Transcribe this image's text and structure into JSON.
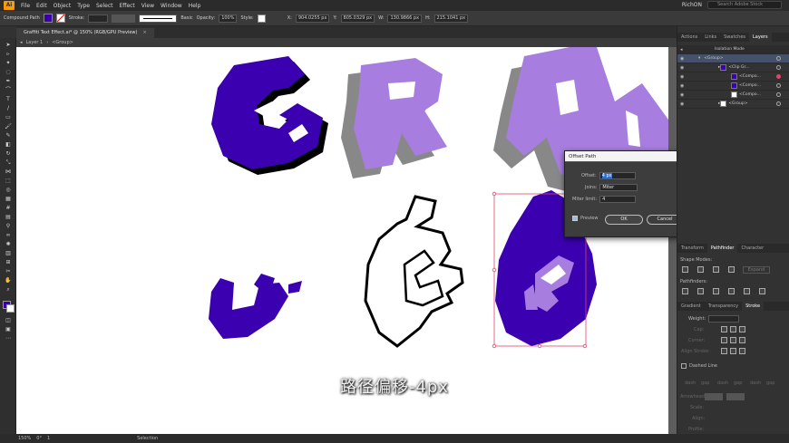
{
  "app": {
    "logo": "Ai",
    "menu": [
      "File",
      "Edit",
      "Object",
      "Type",
      "Select",
      "Effect",
      "View",
      "Window",
      "Help"
    ],
    "user": "RichON",
    "search_placeholder": "Search Adobe Stock"
  },
  "control_bar": {
    "selection_type": "Compound Path",
    "stroke_label": "Stroke:",
    "stroke_preset": "Basic",
    "opacity_label": "Opacity:",
    "opacity_value": "100%",
    "style_label": "Style:",
    "x_label": "X:",
    "x_value": "904.0255 px",
    "y_label": "Y:",
    "y_value": "805.0329 px",
    "w_label": "W:",
    "w_value": "130.9866 px",
    "h_label": "H:",
    "h_value": "215.1041 px",
    "fill_color": "#3a00a8"
  },
  "document": {
    "tab_title": "Graffiti Text Effect.ai* @ 150% (RGB/GPU Preview)",
    "breadcrumb_layer": "Layer 1",
    "breadcrumb_group": "<Group>"
  },
  "artwork": {
    "purple_dark": "#3b00b0",
    "purple_light": "#a77ddf",
    "shadow_gray": "#888888",
    "selection_color": "#e0476b"
  },
  "dialog": {
    "title": "Offset Path",
    "offset_label": "Offset:",
    "offset_value": "4 px",
    "joins_label": "Joins:",
    "joins_value": "Miter",
    "miter_label": "Miter limit:",
    "miter_value": "4",
    "preview_label": "Preview",
    "preview_checked": true,
    "ok_label": "OK",
    "cancel_label": "Cancel"
  },
  "subtitle": "路径偏移-4px",
  "panels": {
    "top_tabs": [
      "Actions",
      "Links",
      "Swatches",
      "Layers"
    ],
    "isolation_mode": "Isolation Mode",
    "layers": [
      {
        "name": "<Group>"
      },
      {
        "name": "<Clip Gr..."
      },
      {
        "name": "<Compo..."
      },
      {
        "name": "<Compo..."
      },
      {
        "name": "<Compo..."
      },
      {
        "name": "<Group>"
      }
    ],
    "mid_tabs": [
      "Transform",
      "Pathfinder",
      "Character"
    ],
    "shape_modes": "Shape Modes:",
    "expand_label": "Expand",
    "pathfinders": "Pathfinders:",
    "lower_tabs": [
      "Gradient",
      "Transparency",
      "Stroke"
    ],
    "weight_label": "Weight:",
    "cap_label": "Cap:",
    "corner_label": "Corner:",
    "align_label": "Align Stroke:",
    "dashed_label": "Dashed Line",
    "dash_labels": [
      "dash",
      "gap",
      "dash",
      "gap",
      "dash",
      "gap"
    ],
    "arrowheads_label": "Arrowheads:",
    "scale_label": "Scale:",
    "align_small": "Align:",
    "profile_label": "Profile:"
  },
  "status": {
    "zoom": "150%",
    "rotation": "0°",
    "artboard": "1",
    "tool": "Selection"
  }
}
